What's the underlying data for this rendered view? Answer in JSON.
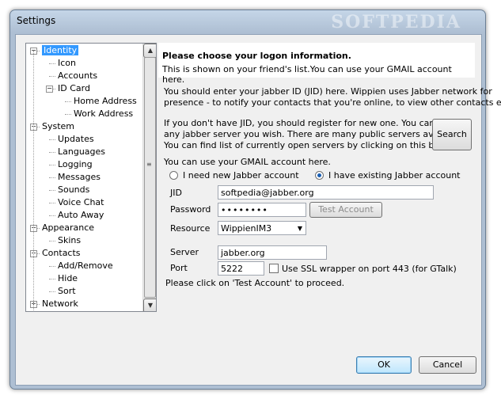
{
  "window": {
    "title": "Settings",
    "watermark": "SOFTPEDIA"
  },
  "tree": {
    "items": [
      {
        "label": "Identity",
        "level": 0,
        "expander": "−",
        "selected": true
      },
      {
        "label": "Icon",
        "level": 1
      },
      {
        "label": "Accounts",
        "level": 1
      },
      {
        "label": "ID Card",
        "level": 1,
        "expander": "−"
      },
      {
        "label": "Home Address",
        "level": 2
      },
      {
        "label": "Work Address",
        "level": 2
      },
      {
        "label": "System",
        "level": 0,
        "expander": "−"
      },
      {
        "label": "Updates",
        "level": 1
      },
      {
        "label": "Languages",
        "level": 1
      },
      {
        "label": "Logging",
        "level": 1
      },
      {
        "label": "Messages",
        "level": 1
      },
      {
        "label": "Sounds",
        "level": 1
      },
      {
        "label": "Voice Chat",
        "level": 1
      },
      {
        "label": "Auto Away",
        "level": 1
      },
      {
        "label": "Appearance",
        "level": 0,
        "expander": "−"
      },
      {
        "label": "Skins",
        "level": 1
      },
      {
        "label": "Contacts",
        "level": 0,
        "expander": "−"
      },
      {
        "label": "Add/Remove",
        "level": 1
      },
      {
        "label": "Hide",
        "level": 1
      },
      {
        "label": "Sort",
        "level": 1
      },
      {
        "label": "Network",
        "level": 0,
        "expander": "+"
      }
    ]
  },
  "header": {
    "title": "Please choose your logon information.",
    "subtitle": "This is shown on your friend's list.You can use your GMAIL account here."
  },
  "info": {
    "line1": "You should enter your jabber ID (JID) here. Wippien uses Jabber network for",
    "line2": "presence - to notify your contacts that you're online, to view other contacts etc.",
    "line3": "If you don't have JID, you should register for new one. You can do it on",
    "line4": "any jabber server you wish. There are many public servers available.",
    "line5": "You can find list of currently open servers by clicking on this button.",
    "gmail": "You can use your GMAIL account here."
  },
  "buttons": {
    "search": "Search",
    "test_account": "Test Account",
    "ok": "OK",
    "cancel": "Cancel"
  },
  "account": {
    "new_label": "I need new Jabber account",
    "existing_label": "I have existing Jabber account",
    "selected": "existing"
  },
  "form": {
    "jid_label": "JID",
    "jid_value": "softpedia@jabber.org",
    "password_label": "Password",
    "password_value": "••••••••",
    "resource_label": "Resource",
    "resource_value": "WippienIM3",
    "server_label": "Server",
    "server_value": "jabber.org",
    "port_label": "Port",
    "port_value": "5222",
    "ssl_label": "Use SSL wrapper on port 443 (for GTalk)",
    "ssl_checked": false
  },
  "hint": "Please click on 'Test Account' to proceed."
}
